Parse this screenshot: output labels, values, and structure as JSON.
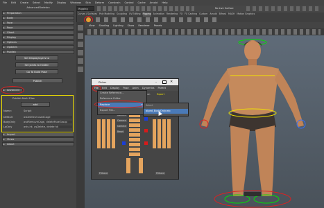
{
  "main_menu": [
    "File",
    "Edit",
    "Create",
    "Select",
    "Modify",
    "Display",
    "Windows",
    "Skin",
    "Deform",
    "Constrain",
    "Control",
    "Cache",
    "Arnold",
    "Help"
  ],
  "shelf": {
    "mode": "Rigging",
    "live_surface": "No Live Surface",
    "tabs": [
      "Curves / Surfaces",
      "Poly Modeling",
      "Sculpting",
      "UV Editing",
      "Rigging",
      "Animation",
      "Rendering",
      "FX",
      "FX Caching",
      "Custom",
      "Arnold",
      "Bifrost",
      "MASH",
      "Motion Graphics"
    ]
  },
  "left_panel": {
    "title": "AdvancedSkeleton",
    "sections_top": [
      "Preparation",
      "Body",
      "Face",
      "Pose",
      "Ghost",
      "Display",
      "Options",
      "Updates",
      "Publish"
    ],
    "buttons": {
      "set_display_layers": "Set Displaylayers to",
      "set_joints_hidden": "Set Joints to hidden",
      "go_to_build_pose": "Go To Build Pose",
      "publish": "Publish"
    },
    "advanced_label": "Advanced",
    "publish_multi_files": "Publish Multi Files",
    "add_button": "add",
    "table_headers": [
      "Name:",
      "Script:"
    ],
    "rows": [
      {
        "name": "Default",
        "script": "asDeleteUnusedCage"
      },
      {
        "name": "BodyOnly",
        "script": "asdRemoveCage, deleteFaceGroup"
      },
      {
        "name": "LoOnly",
        "script": "asts.hk, asDelete, delete hk"
      }
    ],
    "sections_bottom": [
      "Import",
      "Views",
      "About"
    ]
  },
  "viewport_menu": [
    "View",
    "Shading",
    "Lighting",
    "Show",
    "Renderer",
    "Panels"
  ],
  "picker_dialog": {
    "title": "Picker",
    "menu": [
      "File",
      "Edit",
      "Display",
      "Pose",
      "Anim",
      "Dynamics",
      "Parent"
    ],
    "version": "version",
    "active_item": "Export",
    "dropdown_items": [
      "Create Reference...",
      "Reference Editor",
      "Replace",
      "Export File..."
    ],
    "submenu_header": "Select",
    "submenu_item": "biped_BodyOnly.mb",
    "side_labels": [
      "Camera",
      "Camera",
      "Camera",
      "Reset"
    ],
    "bottom_labels": [
      "FKIkant",
      "FKIkant"
    ]
  },
  "colors": {
    "highlight_yellow": "#f2e200",
    "annotation_red": "#e02020",
    "picker_orange": "#e4a45e",
    "selection_blue": "#4a7ab8"
  }
}
